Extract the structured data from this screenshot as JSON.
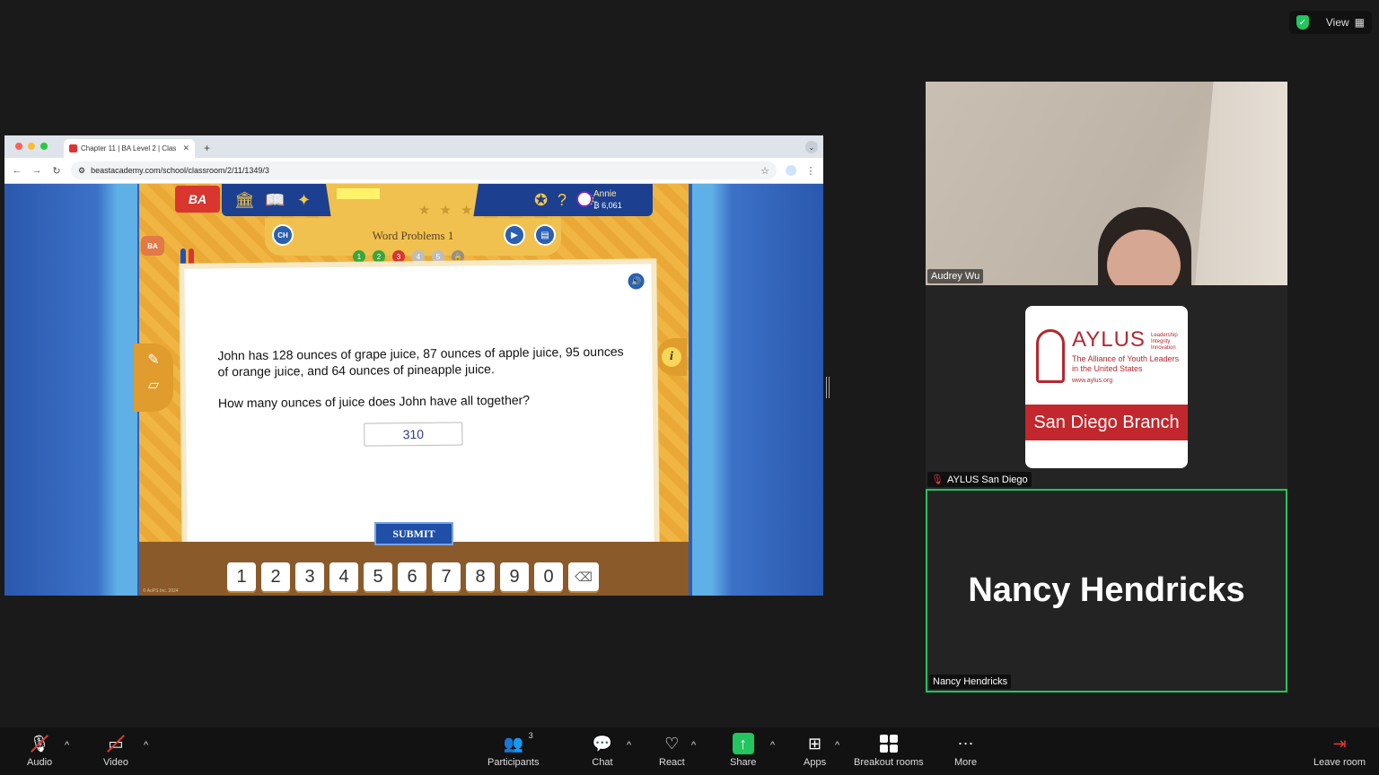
{
  "topright": {
    "view_label": "View"
  },
  "browser": {
    "tab_title": "Chapter 11 | BA Level 2 | Clas",
    "url": "beastacademy.com/school/classroom/2/11/1349/3"
  },
  "game": {
    "logo": "BA",
    "user_name": "Annie",
    "user_coins": "6,061",
    "lesson_title": "Word Problems 1",
    "chapter_badge": "CH",
    "steps": [
      "1",
      "2",
      "3",
      "4",
      "5"
    ],
    "question": "John has 128 ounces of grape juice, 87 ounces of apple juice, 95 ounces of orange juice, and 64 ounces of pineapple juice.",
    "question2": "How many ounces of juice does John have all together?",
    "answer_value": "310",
    "submit_label": "SUBMIT",
    "numpad": [
      "1",
      "2",
      "3",
      "4",
      "5",
      "6",
      "7",
      "8",
      "9",
      "0"
    ],
    "copyright": "© AoPS Inc. 2024",
    "colors": {
      "step_done": "#3aa63a",
      "step_current": "#d8362f",
      "step_todo": "#bdbdbd"
    }
  },
  "participants": [
    {
      "name": "Audrey Wu"
    },
    {
      "name": "AYLUS San Diego",
      "muted": true
    },
    {
      "name": "Nancy Hendricks",
      "active_speaker": true
    }
  ],
  "aylus_card": {
    "name": "AYLUS",
    "tagline": [
      "Leadership",
      "Integrity",
      "Innovation"
    ],
    "subtitle": "The Alliance of Youth Leaders in the United States",
    "website": "www.aylus.org",
    "branch": "San Diego Branch"
  },
  "big_name": "Nancy Hendricks",
  "toolbar": {
    "audio": "Audio",
    "video": "Video",
    "participants": "Participants",
    "participants_count": "3",
    "chat": "Chat",
    "react": "React",
    "share": "Share",
    "apps": "Apps",
    "breakout": "Breakout rooms",
    "more": "More",
    "leave": "Leave room"
  }
}
